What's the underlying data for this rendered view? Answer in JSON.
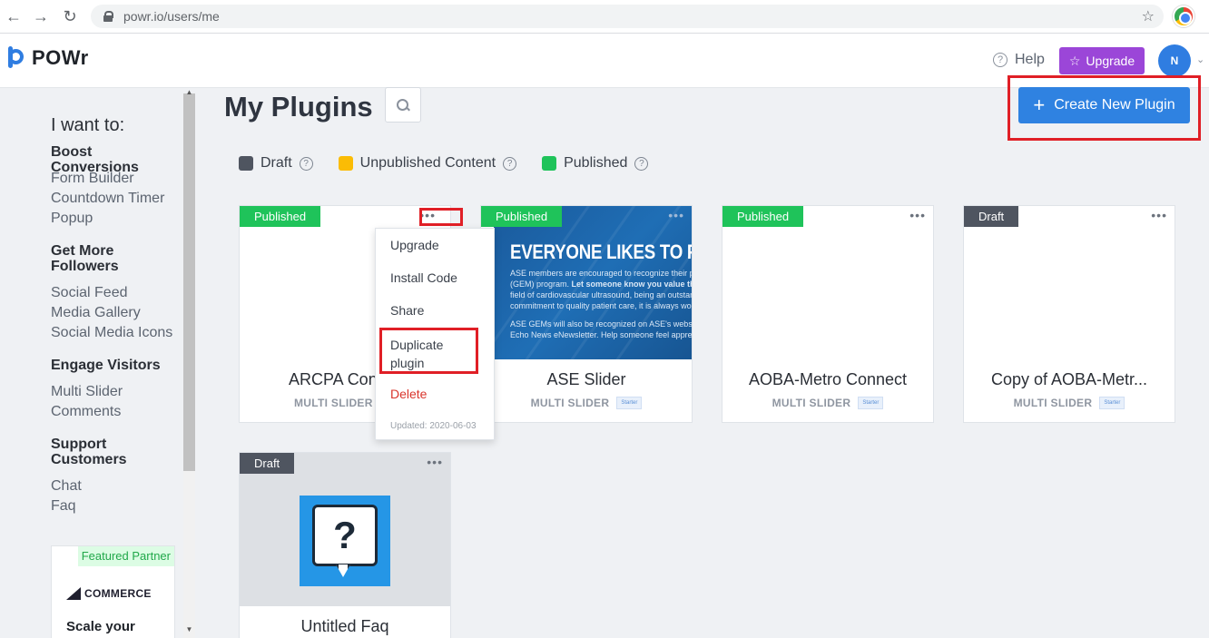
{
  "browser": {
    "url": "powr.io/users/me"
  },
  "header": {
    "logo_text": "POWr",
    "help_label": "Help",
    "upgrade_label": "Upgrade",
    "avatar_initial": "N"
  },
  "sidebar": {
    "heading": "I want to:",
    "groups": [
      {
        "title": "Boost Conversions",
        "links": [
          "Form Builder",
          "Countdown Timer",
          "Popup"
        ]
      },
      {
        "title": "Get More Followers",
        "links": [
          "Social Feed",
          "Media Gallery",
          "Social Media Icons"
        ]
      },
      {
        "title": "Engage Visitors",
        "links": [
          "Multi Slider",
          "Comments"
        ]
      },
      {
        "title": "Support Customers",
        "links": [
          "Chat",
          "Faq"
        ]
      }
    ],
    "partner": {
      "badge": "Featured Partner",
      "logo_text": "COMMERCE",
      "copy": "Scale your"
    }
  },
  "main": {
    "title": "My Plugins",
    "create_label": "Create New Plugin",
    "legend": [
      {
        "label": "Draft",
        "color": "#4f5560"
      },
      {
        "label": "Unpublished Content",
        "color": "#fbbc05"
      },
      {
        "label": "Published",
        "color": "#1fc35a"
      }
    ],
    "cards": [
      {
        "status": "Published",
        "name": "ARCPA Conn",
        "type": "MULTI SLIDER",
        "tier": ""
      },
      {
        "status": "Published",
        "name": "ASE Slider",
        "type": "MULTI SLIDER",
        "tier": "Starter"
      },
      {
        "status": "Published",
        "name": "AOBA-Metro Connect",
        "type": "MULTI SLIDER",
        "tier": "Starter"
      },
      {
        "status": "Draft",
        "name": "Copy of AOBA-Metr...",
        "type": "MULTI SLIDER",
        "tier": "Starter"
      },
      {
        "status": "Draft",
        "name": "Untitled Faq",
        "type": "",
        "tier": ""
      }
    ],
    "slider_preview": {
      "headline": "EVERYONE LIKES TO FEE",
      "body_line1": "ASE members are encouraged to recognize their peers",
      "body_line2": "(GEM) program.",
      "body_bold": "Let someone know you value ther",
      "body_line3": "field of cardiovascular ultrasound, being an outstanding",
      "body_line4": "commitment to quality patient care, it is always worth r",
      "body_line5": "ASE GEMs will also be recognized on ASE's website, on",
      "body_line6": "Echo News eNewsletter. Help someone feel appreciated"
    },
    "context_menu": {
      "items": [
        "Upgrade",
        "Install Code",
        "Share",
        "Duplicate plugin",
        "Delete"
      ],
      "duplicate_line1": "Duplicate",
      "duplicate_line2": "plugin",
      "updated": "Updated: 2020-06-03"
    },
    "icons": {
      "menu": "•••"
    }
  },
  "colors": {
    "accent": "#2f82e1",
    "upgrade": "#9b46d8",
    "published": "#1fc35a",
    "draft": "#4f5560",
    "highlight": "#e01f26"
  }
}
